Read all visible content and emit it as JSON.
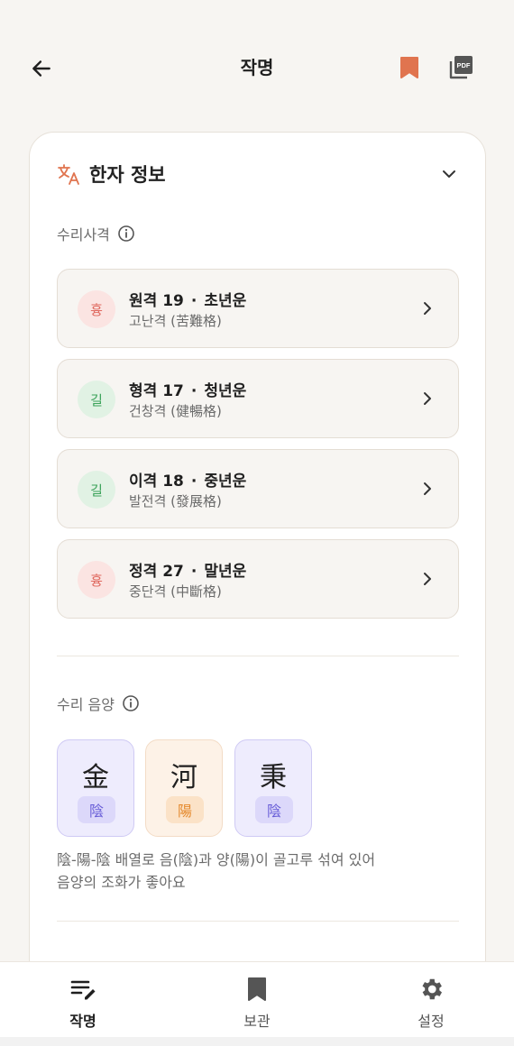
{
  "header": {
    "title": "작명"
  },
  "card": {
    "section_title": "한자 정보",
    "suri_label": "수리사격",
    "rows": [
      {
        "badge": "흉",
        "tone": "bad",
        "name": "원격 19",
        "period": "초년운",
        "sub": "고난격 (苦難格)"
      },
      {
        "badge": "길",
        "tone": "good",
        "name": "형격 17",
        "period": "청년운",
        "sub": "건창격 (健暢格)"
      },
      {
        "badge": "길",
        "tone": "good",
        "name": "이격 18",
        "period": "중년운",
        "sub": "발전격 (發展格)"
      },
      {
        "badge": "흉",
        "tone": "bad",
        "name": "정격 27",
        "period": "말년운",
        "sub": "중단격 (中斷格)"
      }
    ],
    "dot": "·",
    "yinyang_label": "수리 음양",
    "tiles": [
      {
        "hanja": "金",
        "yy": "陰",
        "type": "yin"
      },
      {
        "hanja": "河",
        "yy": "陽",
        "type": "yang"
      },
      {
        "hanja": "秉",
        "yy": "陰",
        "type": "yin"
      }
    ],
    "desc_line1": "陰-陽-陰 배열로 음(陰)과 양(陽)이 골고루 섞여 있어",
    "desc_line2": "음양의 조화가 좋아요"
  },
  "nav": {
    "items": [
      {
        "label": "작명",
        "icon": "edit-list-icon"
      },
      {
        "label": "보관",
        "icon": "bookmark-icon"
      },
      {
        "label": "설정",
        "icon": "gear-icon"
      }
    ],
    "active": 0
  },
  "colors": {
    "accent": "#e0744f",
    "bad": "#e06a60",
    "good": "#3ca35a",
    "yin": "#6a5fd8",
    "yang": "#e58a2e"
  }
}
